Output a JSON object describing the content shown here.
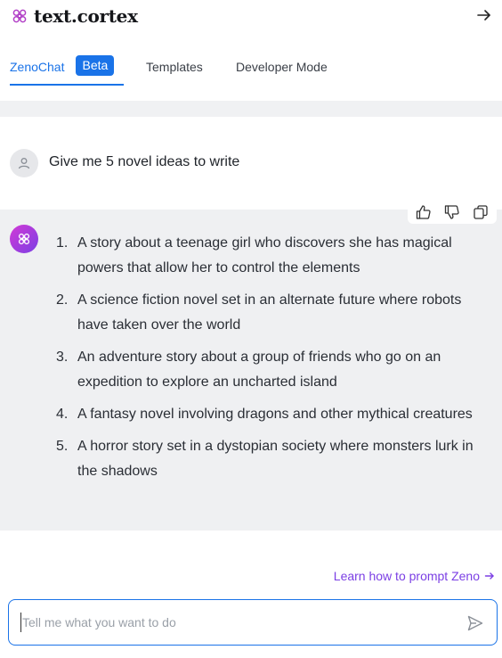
{
  "brand": {
    "name": "text.cortex"
  },
  "tabs": [
    {
      "label": "ZenoChat",
      "badge": "Beta",
      "active": true
    },
    {
      "label": "Templates"
    },
    {
      "label": "Developer Mode"
    }
  ],
  "conversation": {
    "user_message": "Give me 5 novel ideas to write",
    "ai_response": {
      "items": [
        {
          "num": "1.",
          "text": "A story about a teenage girl who discovers she has magical powers that allow her to control the elements"
        },
        {
          "num": "2.",
          "text": "A science fiction novel set in an alternate future where robots have taken over the world"
        },
        {
          "num": "3.",
          "text": "An adventure story about a group of friends who go on an expedition to explore an uncharted island"
        },
        {
          "num": "4.",
          "text": "A fantasy novel involving dragons and other mythical creatures"
        },
        {
          "num": "5.",
          "text": "A horror story set in a dystopian society where monsters lurk in the shadows"
        }
      ]
    }
  },
  "learn_link": "Learn how to prompt Zeno",
  "composer": {
    "placeholder": "Tell me what you want to do",
    "value": ""
  },
  "colors": {
    "accent": "#1a73e8",
    "brand_purple": "#7b3fe4",
    "ai_bg": "#eff0f2"
  }
}
